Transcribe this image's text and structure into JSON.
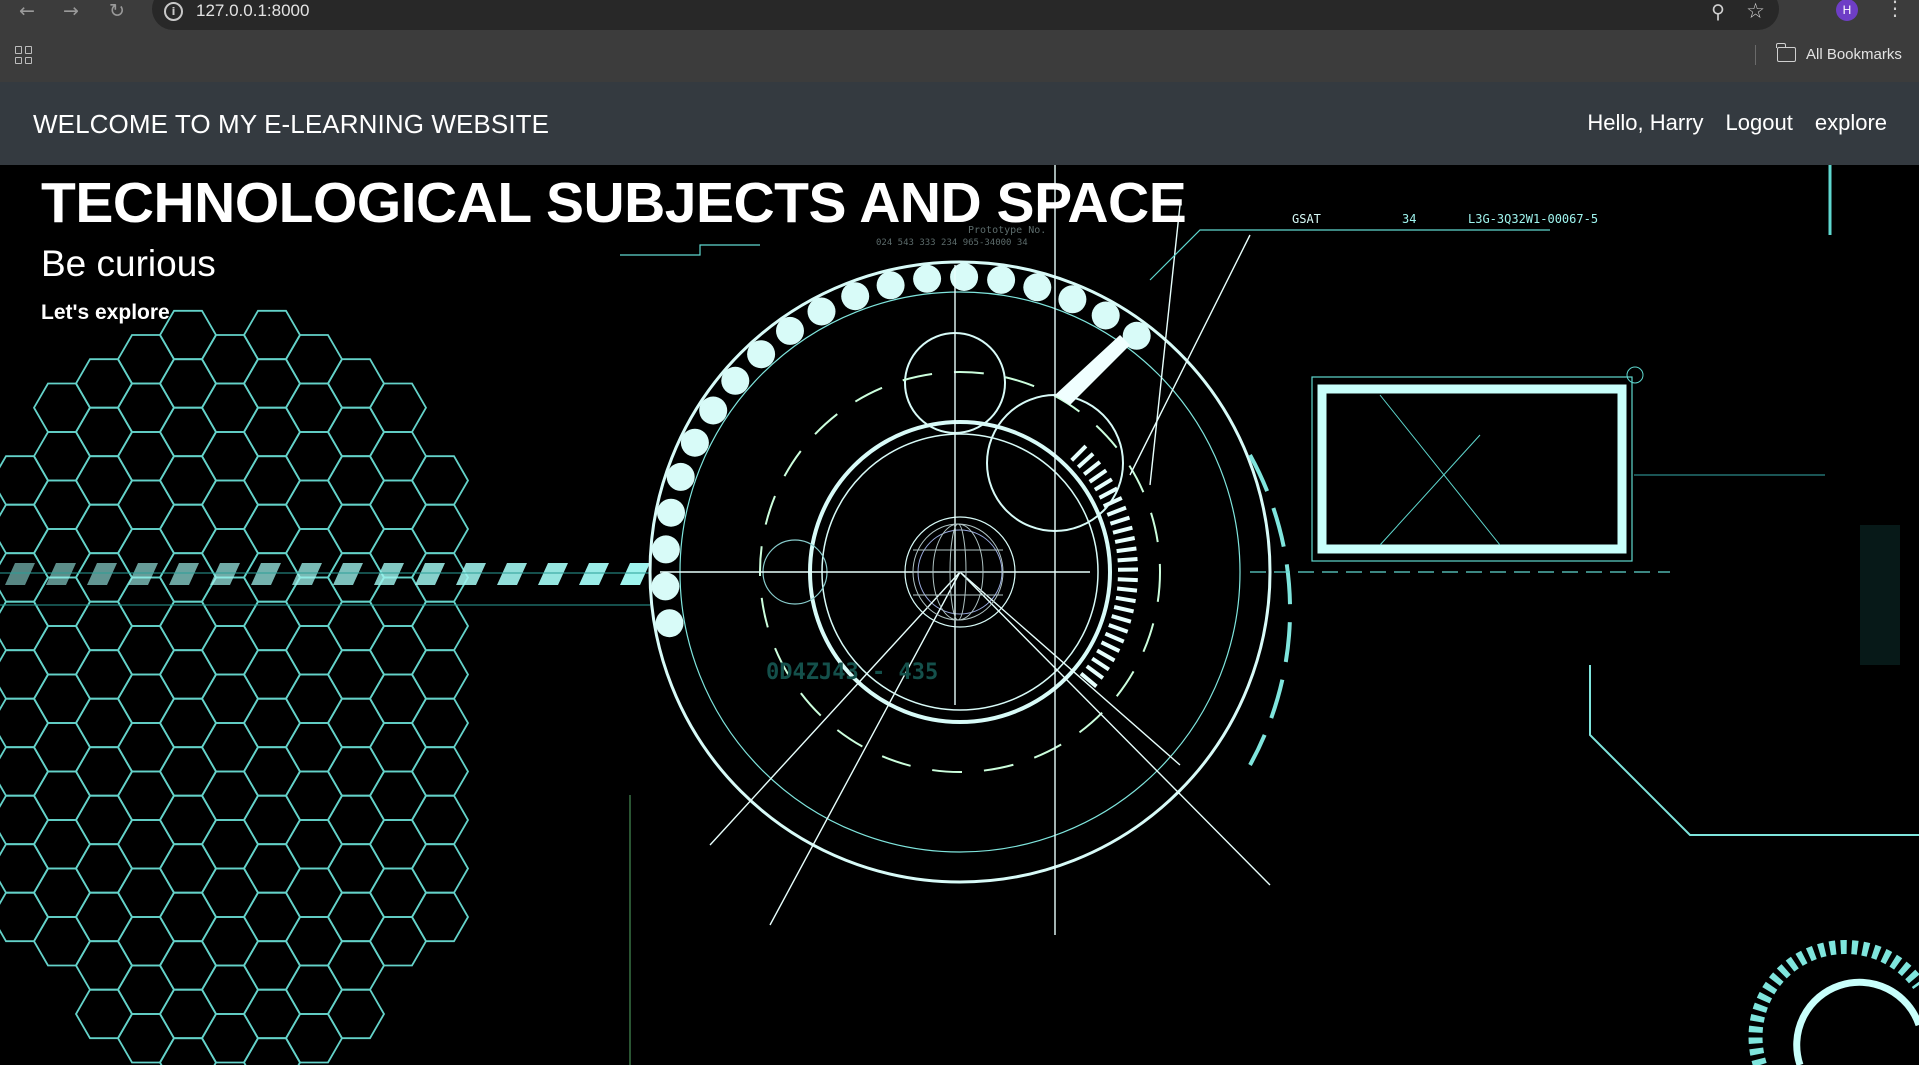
{
  "browser": {
    "url": "127.0.0.1:8000",
    "profile_initial": "H",
    "bookmarks_label": "All Bookmarks",
    "icons": [
      "back-icon",
      "forward-icon",
      "reload-icon",
      "info-icon",
      "zoom-icon",
      "star-icon",
      "menu-icon",
      "apps-icon",
      "folder-icon"
    ]
  },
  "navbar": {
    "brand": "WELCOME TO MY E-LEARNING WEBSITE",
    "greeting": "Hello, Harry",
    "logout": "Logout",
    "explore": "explore",
    "background": "#343a40"
  },
  "hero": {
    "title": "TECHNOLOGICAL SUBJECTS AND SPACE",
    "subtitle": "Be curious",
    "cta": "Let's explore",
    "background_image": "futuristic HUD",
    "hud_codes": {
      "gsat": "GSAT",
      "num": "34",
      "id": "L3G-3Q32W1-00067-5",
      "prototype": "Prototype No.",
      "serial": "024 543 333 234 965-34000 34",
      "bignum": "0D4ZJ43 - 435"
    },
    "accent_color": "#7df3ec"
  }
}
